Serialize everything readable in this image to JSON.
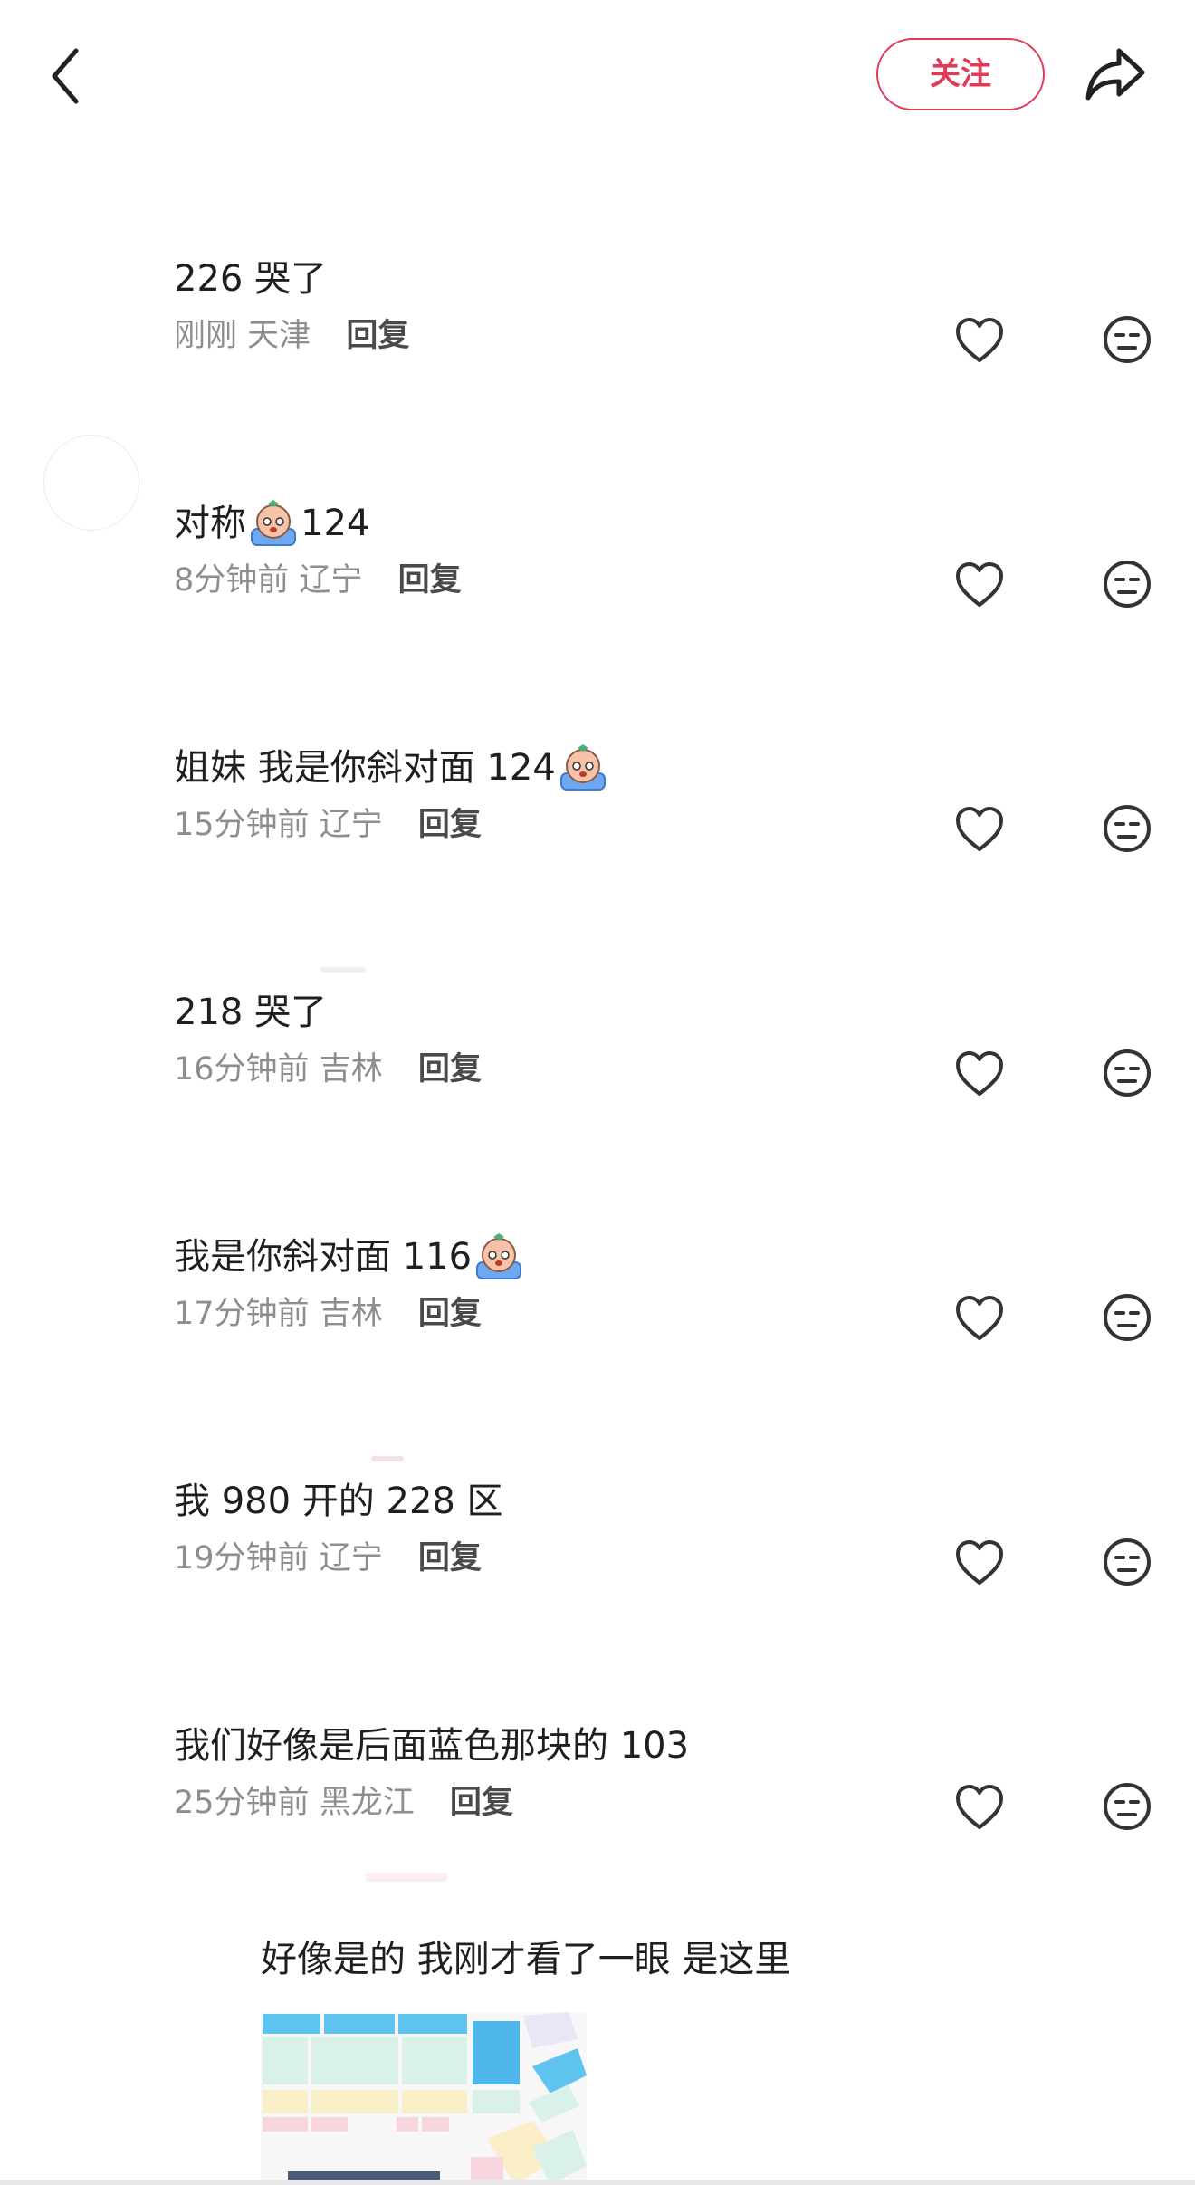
{
  "header": {
    "follow_label": "关注"
  },
  "comments": [
    {
      "text": "226 哭了",
      "emoji": false,
      "time": "刚刚",
      "location": "天津",
      "reply": "回复"
    },
    {
      "text_before": "对称",
      "text_after": "124",
      "emoji": true,
      "time": "8分钟前",
      "location": "辽宁",
      "reply": "回复"
    },
    {
      "text_before": "姐妹 我是你斜对面 124",
      "text_after": "",
      "emoji": true,
      "time": "15分钟前",
      "location": "辽宁",
      "reply": "回复"
    },
    {
      "text": "218 哭了",
      "emoji": false,
      "time": "16分钟前",
      "location": "吉林",
      "reply": "回复"
    },
    {
      "text_before": "我是你斜对面 116",
      "text_after": "",
      "emoji": true,
      "time": "17分钟前",
      "location": "吉林",
      "reply": "回复"
    },
    {
      "text": "我 980 开的 228 区",
      "emoji": false,
      "time": "19分钟前",
      "location": "辽宁",
      "reply": "回复"
    },
    {
      "text": "我们好像是后面蓝色那块的 103",
      "emoji": false,
      "time": "25分钟前",
      "location": "黑龙江",
      "reply": "回复"
    }
  ],
  "sub_reply": {
    "text": "好像是的 我刚才看了一眼 是这里"
  },
  "icons": {
    "back": "chevron-left-icon",
    "share": "share-arrow-icon",
    "like": "heart-outline-icon",
    "dislike": "neutral-face-icon",
    "emoji": "crying-face-emoji"
  },
  "colors": {
    "accent": "#e03a57",
    "text": "#1f1f1f",
    "meta": "#8e8e8e"
  }
}
